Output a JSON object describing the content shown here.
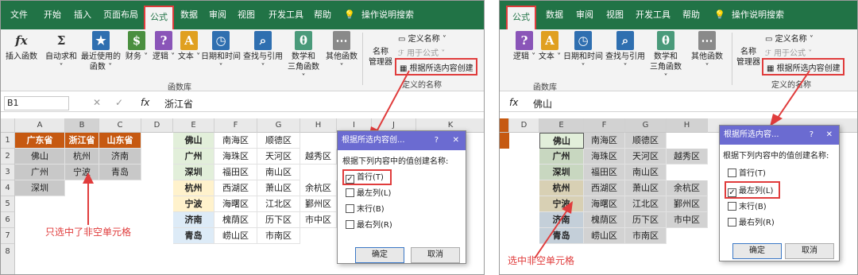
{
  "left": {
    "tabs": [
      "文件",
      "开始",
      "插入",
      "页面布局",
      "公式",
      "数据",
      "审阅",
      "视图",
      "开发工具",
      "帮助"
    ],
    "search": "操作说明搜索",
    "ribbon": {
      "insert_fn": "插入函数",
      "autosum": "自动求和",
      "recent": "最近使用的",
      "recent2": "函数",
      "finance": "财务",
      "logic": "逻辑",
      "text": "文本",
      "datetime": "日期和时间",
      "lookup": "查找与引用",
      "math": "数学和",
      "math2": "三角函数",
      "other": "其他函数",
      "namemgr": "名称",
      "namemgr2": "管理器",
      "define": "定义名称",
      "usein": "用于公式",
      "create": "根据所选内容创建",
      "fnlib": "函数库",
      "defnames": "定义的名称"
    },
    "namebox": "B1",
    "formula": "浙江省",
    "cols": [
      "A",
      "B",
      "C",
      "D",
      "E",
      "F",
      "G",
      "H",
      "I",
      "J",
      "K"
    ],
    "rows": [
      "1",
      "2",
      "3",
      "4",
      "5",
      "6",
      "7",
      "8"
    ],
    "abc": [
      [
        "广东省",
        "浙江省",
        "山东省"
      ],
      [
        "佛山",
        "杭州",
        "济南"
      ],
      [
        "广州",
        "宁波",
        "青岛"
      ],
      [
        "深圳",
        "",
        ""
      ]
    ],
    "efgh": [
      [
        "佛山",
        "南海区",
        "顺德区",
        ""
      ],
      [
        "广州",
        "海珠区",
        "天河区",
        "越秀区"
      ],
      [
        "深圳",
        "福田区",
        "南山区",
        ""
      ],
      [
        "杭州",
        "西湖区",
        "萧山区",
        "余杭区"
      ],
      [
        "宁波",
        "海曙区",
        "江北区",
        "鄞州区"
      ],
      [
        "济南",
        "槐荫区",
        "历下区",
        "市中区"
      ],
      [
        "青岛",
        "崂山区",
        "市南区",
        ""
      ]
    ],
    "dialog": {
      "title": "根据所选内容创...",
      "help": "?",
      "close": "✕",
      "prompt": "根据下列内容中的值创建名称:",
      "opts": [
        "首行(T)",
        "最左列(L)",
        "末行(B)",
        "最右列(R)"
      ],
      "ok": "确定",
      "cancel": "取消"
    },
    "annotation": "只选中了非空单元格"
  },
  "right": {
    "tabs": [
      "公式",
      "数据",
      "审阅",
      "视图",
      "开发工具",
      "帮助"
    ],
    "search": "操作说明搜索",
    "ribbon": {
      "logic": "逻辑",
      "text": "文本",
      "datetime": "日期和时间",
      "lookup": "查找与引用",
      "math": "数学和",
      "math2": "三角函数",
      "other": "其他函数",
      "namemgr": "名称",
      "namemgr2": "管理器",
      "define": "定义名称",
      "usein": "用于公式",
      "create": "根据所选内容创建",
      "fnlib": "函数库",
      "defnames": "定义的名称"
    },
    "formula": "佛山",
    "cols": [
      "D",
      "E",
      "F",
      "G",
      "H"
    ],
    "efgh": [
      [
        "佛山",
        "南海区",
        "顺德区",
        ""
      ],
      [
        "广州",
        "海珠区",
        "天河区",
        "越秀区"
      ],
      [
        "深圳",
        "福田区",
        "南山区",
        ""
      ],
      [
        "杭州",
        "西湖区",
        "萧山区",
        "余杭区"
      ],
      [
        "宁波",
        "海曙区",
        "江北区",
        "鄞州区"
      ],
      [
        "济南",
        "槐荫区",
        "历下区",
        "市中区"
      ],
      [
        "青岛",
        "崂山区",
        "市南区",
        ""
      ]
    ],
    "dialog": {
      "title": "根据所选内容...",
      "help": "?",
      "close": "✕",
      "prompt": "根据下列内容中的值创建名称:",
      "opts": [
        "首行(T)",
        "最左列(L)",
        "末行(B)",
        "最右列(R)"
      ],
      "ok": "确定",
      "cancel": "取消"
    },
    "annotation": "选中非空单元格"
  },
  "colors": {
    "excel_green": "#217346",
    "highlight": "#e03c3c",
    "orange": "#c65911",
    "dialog_title": "#6b6bd1"
  }
}
